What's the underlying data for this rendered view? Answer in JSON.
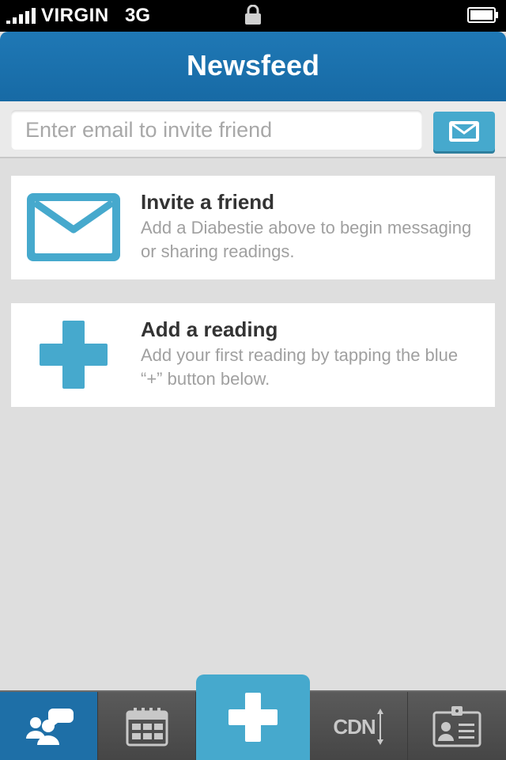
{
  "status_bar": {
    "carrier": "VIRGIN",
    "network": "3G"
  },
  "header": {
    "title": "Newsfeed"
  },
  "invite": {
    "placeholder": "Enter email to invite friend",
    "value": ""
  },
  "cards": [
    {
      "icon": "mail-icon",
      "title": "Invite a friend",
      "text": "Add a Diabestie above to begin messaging or sharing readings."
    },
    {
      "icon": "plus-icon",
      "title": "Add a reading",
      "text": "Add your first reading by tapping the blue “+” button below."
    }
  ],
  "tab_bar": {
    "active_tab": "newsfeed",
    "tabs": [
      {
        "name": "newsfeed",
        "icon": "people-chat-icon"
      },
      {
        "name": "calendar",
        "icon": "calendar-icon"
      },
      {
        "name": "add-reading",
        "icon": "plus-icon"
      },
      {
        "name": "cdn",
        "icon": "cdn-icon",
        "label": "CDN"
      },
      {
        "name": "profile",
        "icon": "id-card-icon"
      }
    ]
  },
  "colors": {
    "header": "#1f78b5",
    "accent": "#46a9cd",
    "active_tab": "#1e6fa7",
    "tab_bar": "#505050",
    "background": "#dedede"
  }
}
